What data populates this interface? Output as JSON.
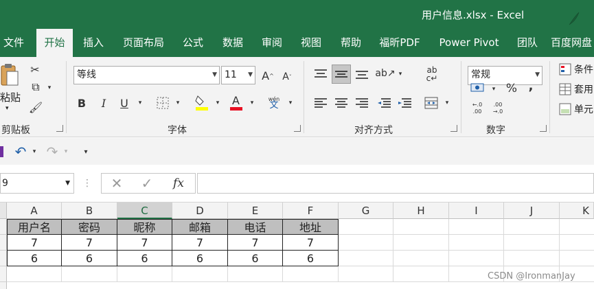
{
  "window": {
    "title": "用户信息.xlsx  -  Excel"
  },
  "tabs": [
    {
      "label": "文件"
    },
    {
      "label": "开始"
    },
    {
      "label": "插入"
    },
    {
      "label": "页面布局"
    },
    {
      "label": "公式"
    },
    {
      "label": "数据"
    },
    {
      "label": "审阅"
    },
    {
      "label": "视图"
    },
    {
      "label": "帮助"
    },
    {
      "label": "福昕PDF"
    },
    {
      "label": "Power Pivot"
    },
    {
      "label": "团队"
    },
    {
      "label": "百度网盘"
    }
  ],
  "ribbon": {
    "clipboard": {
      "paste_label": "粘贴",
      "group_label": "剪贴板"
    },
    "font": {
      "font_name": "等线",
      "font_size": "11",
      "bold": "B",
      "italic": "I",
      "underline": "U",
      "group_label": "字体",
      "phonetic_small": "wén",
      "phonetic_big": "文"
    },
    "alignment": {
      "group_label": "对齐方式"
    },
    "number": {
      "format": "常规",
      "percent": "%",
      "comma": ",",
      "group_label": "数字",
      "inc_top": "←.0",
      "inc_bottom": ".00",
      "dec_top": ".00",
      "dec_bottom": "→.0"
    },
    "styles": {
      "cond_format": "条件",
      "format_table": "套用",
      "cell_styles": "单元"
    }
  },
  "formula_bar": {
    "name_box": "9",
    "formula": "",
    "fx": "fx"
  },
  "sheet": {
    "columns": [
      "A",
      "B",
      "C",
      "D",
      "E",
      "F",
      "G",
      "H",
      "I",
      "J",
      "K"
    ],
    "selected_column": "C",
    "rows": [
      [
        "用户名",
        "密码",
        "昵称",
        "邮箱",
        "电话",
        "地址"
      ],
      [
        "7",
        "7",
        "7",
        "7",
        "7",
        "7"
      ],
      [
        "6",
        "6",
        "6",
        "6",
        "6",
        "6"
      ]
    ]
  },
  "watermark": "CSDN @IronmanJay",
  "colors": {
    "accent": "#217346",
    "header_fill": "#bfbfbf"
  }
}
